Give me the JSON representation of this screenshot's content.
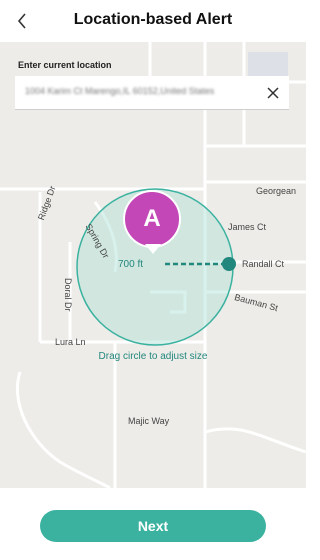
{
  "header": {
    "title": "Location-based Alert",
    "back_icon": "chevron-left-icon"
  },
  "location": {
    "label": "Enter current location",
    "value": "1004 Karim Ct Marengo,IL 60152,United States",
    "clear_icon": "close-icon"
  },
  "map": {
    "streets": [
      "Ridge Dr",
      "Spring Dr",
      "James Ct",
      "Randall Ct",
      "Bauman St",
      "Doral Dr",
      "Lura Ln",
      "Majic Way",
      "Georgean"
    ],
    "pin_letter": "A",
    "radius_label": "700 ft",
    "hint": "Drag circle to adjust size"
  },
  "footer": {
    "next_label": "Next"
  },
  "colors": {
    "accent": "#3bb2a0",
    "accent_dark": "#22877d",
    "pin": "#c347b7",
    "map_bg": "#eeece8"
  }
}
